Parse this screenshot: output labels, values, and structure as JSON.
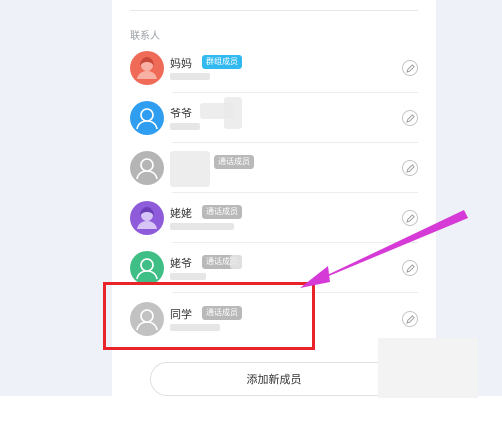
{
  "section_title": "联系人",
  "contacts": [
    {
      "name": "妈妈",
      "badge": "群组成员",
      "badge_color": "#32b9ef",
      "avatar_color": "#ef6b57"
    },
    {
      "name": "爷爷",
      "badge": "",
      "badge_color": "#b9b9b9",
      "avatar_color": "#2f9df0"
    },
    {
      "name": "",
      "badge": "通话成员",
      "badge_color": "#b9b9b9",
      "avatar_color": "#b5b5b5"
    },
    {
      "name": "姥姥",
      "badge": "通话成员",
      "badge_color": "#b9b9b9",
      "avatar_color": "#8e5cdb"
    },
    {
      "name": "姥爷",
      "badge": "通话成员",
      "badge_color": "#b9b9b9",
      "avatar_color": "#3fbf86"
    },
    {
      "name": "同学",
      "badge": "通话成员",
      "badge_color": "#b9b9b9",
      "avatar_color": "#c2c2c2"
    }
  ],
  "add_member_label": "添加新成员",
  "icons": {
    "avatar": "person-icon",
    "edit": "pencil-icon"
  },
  "annotation": {
    "highlight_color": "#e8232a",
    "arrow_color": "#d63ad6"
  }
}
